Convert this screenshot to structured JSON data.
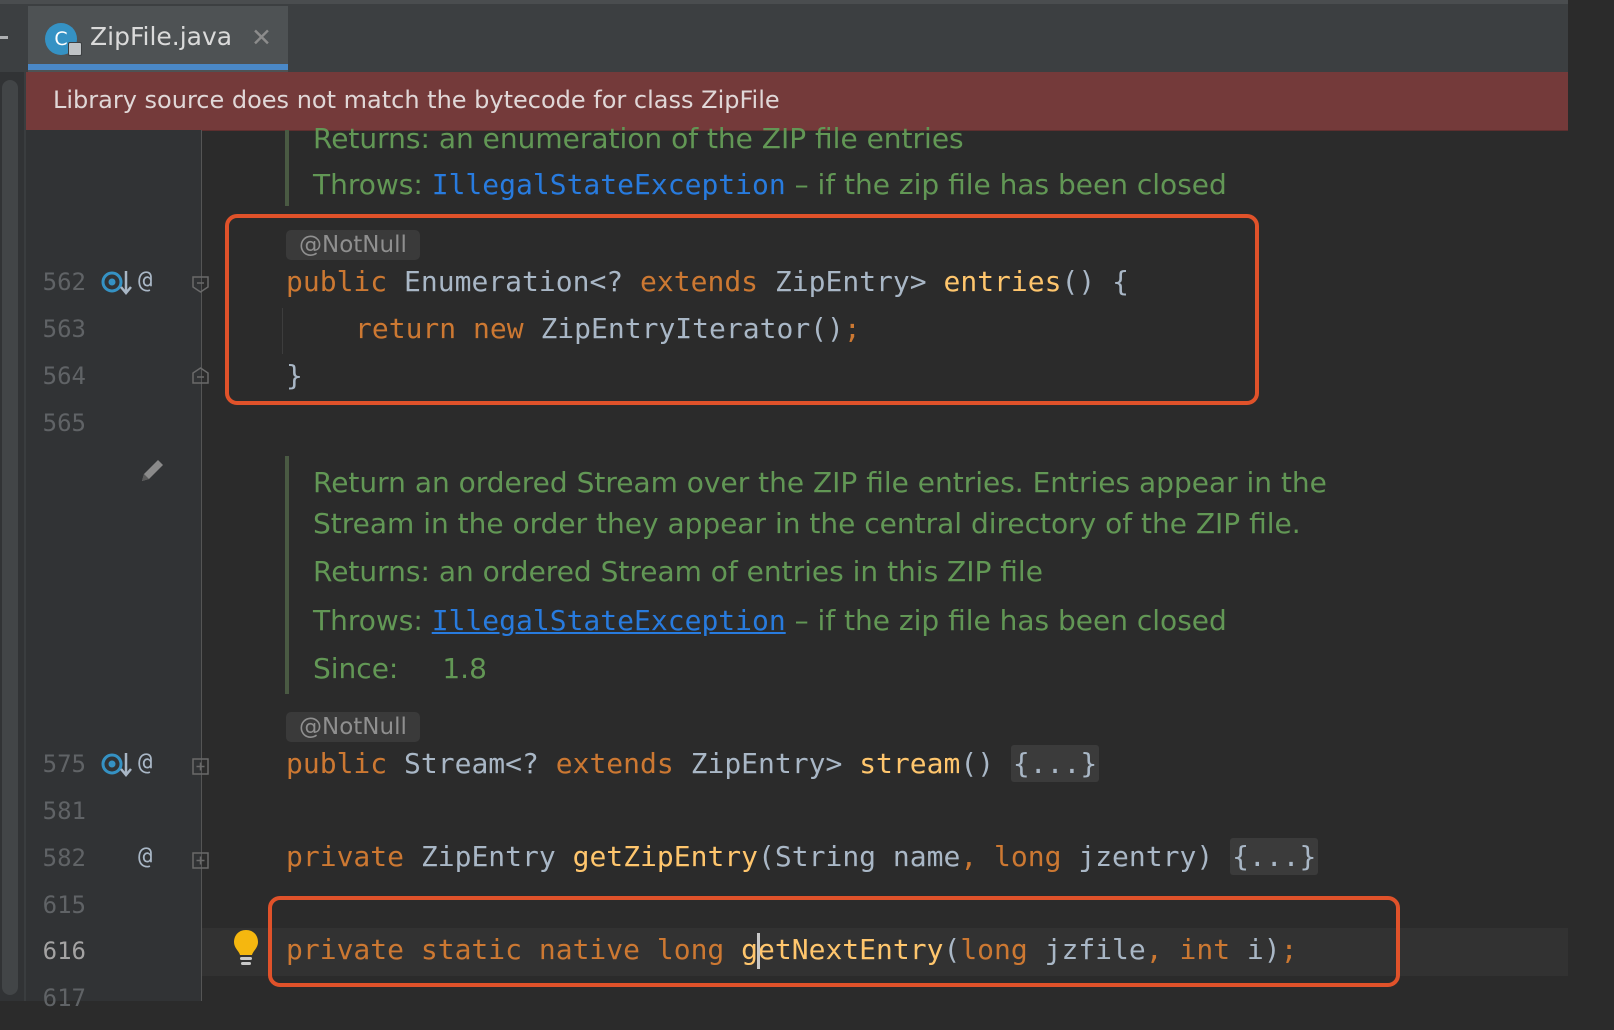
{
  "editor": {
    "tab": {
      "title": "ZipFile.java",
      "icon_letter": "C",
      "close_glyph": "✕"
    },
    "banner": {
      "text": "Library source does not match the bytecode for class ZipFile",
      "color": "#743a3a"
    },
    "doc_top": {
      "returns": "Returns: an enumeration of the ZIP file entries",
      "throws_label": "Throws:",
      "throws_link": "IllegalStateException",
      "throws_rest": " – if the zip file has been closed"
    },
    "doc_stream": {
      "line1": "Return an ordered Stream over the ZIP file entries. Entries appear in the",
      "line2": "Stream in the order they appear in the central directory of the ZIP file.",
      "returns": "Returns: an ordered Stream of entries in this ZIP file",
      "throws_label": "Throws:",
      "throws_link": "IllegalStateException",
      "throws_rest": " – if the zip file has been closed",
      "since_label": "Since:",
      "since_value": "1.8"
    },
    "annotations": {
      "entries": "@NotNull",
      "stream": "@NotNull"
    },
    "line_numbers": [
      "562",
      "563",
      "564",
      "565",
      "575",
      "581",
      "582",
      "615",
      "616",
      "617"
    ],
    "gutter": {
      "at_symbol": "@"
    },
    "code": {
      "entries_line": {
        "kw": "public",
        "type": " Enumeration<? ",
        "kw2": "extends",
        "type2": " ZipEntry> ",
        "fn": "entries",
        "rest": "() {"
      },
      "return_line": {
        "kw": "return",
        "kw2": " new",
        "rest": " ZipEntryIterator()",
        "semi": ";"
      },
      "close_brace": "}",
      "stream_line": {
        "kw": "public",
        "type": " Stream<? ",
        "kw2": "extends",
        "type2": " ZipEntry> ",
        "fn": "stream",
        "rest": "() ",
        "folded": "{...}"
      },
      "getzip_line": {
        "kw": "private",
        "type": " ZipEntry ",
        "fn": "getZipEntry",
        "p1": "(String name",
        "comma": ",",
        "kw2": " long",
        "p2": " jzentry) ",
        "folded": "{...}"
      },
      "native_line": {
        "kw": "private static native long",
        "space": " ",
        "fn": "getNextEntry",
        "p0": "(",
        "kw2": "long",
        "p1": " jzfile",
        "comma": ",",
        "kw3": " int",
        "p2": " i)",
        "semi": ";"
      }
    },
    "colors": {
      "keyword": "#cc7832",
      "method": "#ffc66d",
      "doc": "#629755",
      "link": "#287bde",
      "highlight_box": "#e0522a"
    }
  }
}
